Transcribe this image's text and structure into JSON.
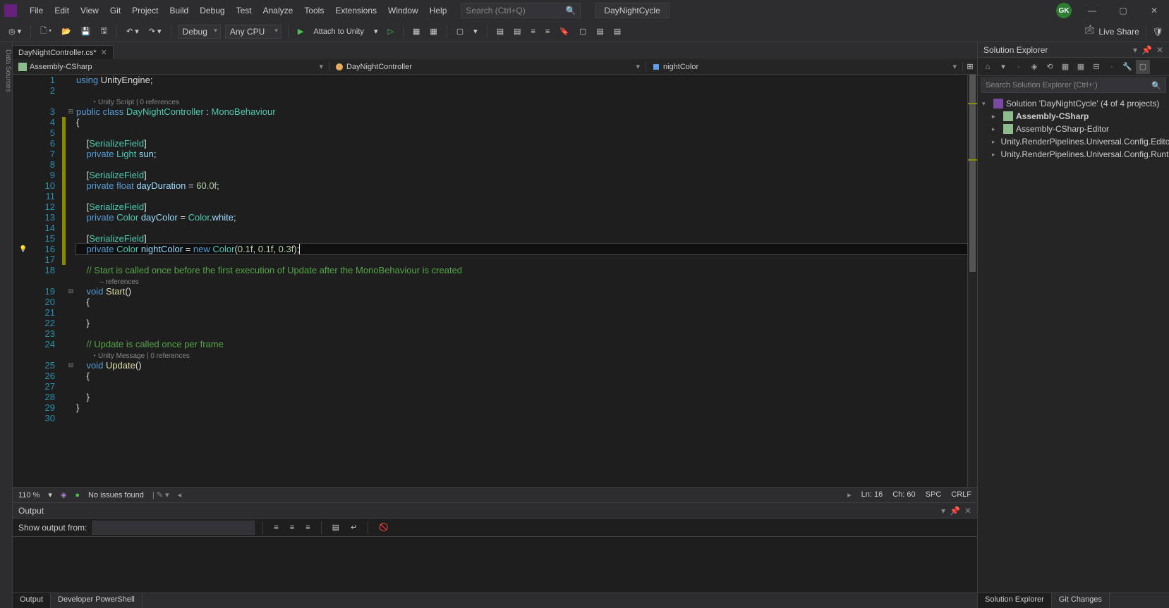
{
  "menubar": {
    "items": [
      "File",
      "Edit",
      "View",
      "Git",
      "Project",
      "Build",
      "Debug",
      "Test",
      "Analyze",
      "Tools",
      "Extensions",
      "Window",
      "Help"
    ],
    "search_placeholder": "Search (Ctrl+Q)",
    "project_name": "DayNightCycle",
    "user_initials": "GK"
  },
  "toolbar": {
    "config": "Debug",
    "platform": "Any CPU",
    "run_label": "Attach to Unity",
    "live_share": "Live Share"
  },
  "tabs": {
    "file": "DayNightController.cs*"
  },
  "navbar": {
    "project": "Assembly-CSharp",
    "class": "DayNightController",
    "member": "nightColor"
  },
  "code": {
    "lines": [
      {
        "n": 1,
        "mod": false,
        "fold": "",
        "seg": [
          [
            "kw",
            "using"
          ],
          [
            "plain",
            " "
          ],
          [
            "plain",
            "UnityEngine"
          ],
          [
            "plain",
            ";"
          ]
        ]
      },
      {
        "n": 2,
        "mod": false,
        "fold": "",
        "seg": []
      },
      {
        "n": null,
        "mod": false,
        "fold": "",
        "seg": [
          [
            "annot",
            "        ◔ Unity Script | 0 references"
          ]
        ]
      },
      {
        "n": 3,
        "mod": false,
        "fold": "⊟",
        "seg": [
          [
            "kw",
            "public"
          ],
          [
            "plain",
            " "
          ],
          [
            "kw",
            "class"
          ],
          [
            "plain",
            " "
          ],
          [
            "type",
            "DayNightController"
          ],
          [
            "plain",
            " : "
          ],
          [
            "type",
            "MonoBehaviour"
          ]
        ]
      },
      {
        "n": 4,
        "mod": true,
        "fold": "",
        "seg": [
          [
            "plain",
            "{"
          ]
        ]
      },
      {
        "n": 5,
        "mod": true,
        "fold": "",
        "seg": []
      },
      {
        "n": 6,
        "mod": true,
        "fold": "",
        "seg": [
          [
            "plain",
            "    ["
          ],
          [
            "type",
            "SerializeField"
          ],
          [
            "plain",
            "]"
          ]
        ]
      },
      {
        "n": 7,
        "mod": true,
        "fold": "",
        "seg": [
          [
            "plain",
            "    "
          ],
          [
            "kw",
            "private"
          ],
          [
            "plain",
            " "
          ],
          [
            "type",
            "Light"
          ],
          [
            "plain",
            " "
          ],
          [
            "var",
            "sun"
          ],
          [
            "plain",
            ";"
          ]
        ]
      },
      {
        "n": 8,
        "mod": true,
        "fold": "",
        "seg": []
      },
      {
        "n": 9,
        "mod": true,
        "fold": "",
        "seg": [
          [
            "plain",
            "    ["
          ],
          [
            "type",
            "SerializeField"
          ],
          [
            "plain",
            "]"
          ]
        ]
      },
      {
        "n": 10,
        "mod": true,
        "fold": "",
        "seg": [
          [
            "plain",
            "    "
          ],
          [
            "kw",
            "private"
          ],
          [
            "plain",
            " "
          ],
          [
            "kw",
            "float"
          ],
          [
            "plain",
            " "
          ],
          [
            "var",
            "dayDuration"
          ],
          [
            "plain",
            " = "
          ],
          [
            "num",
            "60.0f"
          ],
          [
            "plain",
            ";"
          ]
        ]
      },
      {
        "n": 11,
        "mod": true,
        "fold": "",
        "seg": []
      },
      {
        "n": 12,
        "mod": true,
        "fold": "",
        "seg": [
          [
            "plain",
            "    ["
          ],
          [
            "type",
            "SerializeField"
          ],
          [
            "plain",
            "]"
          ]
        ]
      },
      {
        "n": 13,
        "mod": true,
        "fold": "",
        "seg": [
          [
            "plain",
            "    "
          ],
          [
            "kw",
            "private"
          ],
          [
            "plain",
            " "
          ],
          [
            "type",
            "Color"
          ],
          [
            "plain",
            " "
          ],
          [
            "var",
            "dayColor"
          ],
          [
            "plain",
            " = "
          ],
          [
            "type",
            "Color"
          ],
          [
            "plain",
            "."
          ],
          [
            "var",
            "white"
          ],
          [
            "plain",
            ";"
          ]
        ]
      },
      {
        "n": 14,
        "mod": true,
        "fold": "",
        "seg": []
      },
      {
        "n": 15,
        "mod": true,
        "fold": "",
        "seg": [
          [
            "plain",
            "    ["
          ],
          [
            "type",
            "SerializeField"
          ],
          [
            "plain",
            "]"
          ]
        ]
      },
      {
        "n": 16,
        "mod": true,
        "fold": "",
        "hl": true,
        "margin": "💡",
        "seg": [
          [
            "plain",
            "    "
          ],
          [
            "kw",
            "private"
          ],
          [
            "plain",
            " "
          ],
          [
            "type",
            "Color"
          ],
          [
            "plain",
            " "
          ],
          [
            "var",
            "nightColor"
          ],
          [
            "plain",
            " = "
          ],
          [
            "kw",
            "new"
          ],
          [
            "plain",
            " "
          ],
          [
            "type",
            "Color"
          ],
          [
            "plain",
            "("
          ],
          [
            "num",
            "0.1f"
          ],
          [
            "plain",
            ", "
          ],
          [
            "num",
            "0.1f"
          ],
          [
            "plain",
            ", "
          ],
          [
            "num",
            "0.3f"
          ],
          [
            "plain",
            ");"
          ],
          [
            "caret",
            ""
          ]
        ]
      },
      {
        "n": 17,
        "mod": true,
        "fold": "",
        "seg": []
      },
      {
        "n": 18,
        "mod": false,
        "fold": "",
        "seg": [
          [
            "plain",
            "    "
          ],
          [
            "comment",
            "// Start is called once before the first execution of Update after the MonoBehaviour is created"
          ]
        ]
      },
      {
        "n": null,
        "mod": false,
        "fold": "",
        "seg": [
          [
            "annot",
            "            – references"
          ]
        ]
      },
      {
        "n": 19,
        "mod": false,
        "fold": "⊟",
        "seg": [
          [
            "plain",
            "    "
          ],
          [
            "kw",
            "void"
          ],
          [
            "plain",
            " "
          ],
          [
            "ident",
            "Start"
          ],
          [
            "plain",
            "()"
          ]
        ]
      },
      {
        "n": 20,
        "mod": false,
        "fold": "",
        "seg": [
          [
            "plain",
            "    {"
          ]
        ]
      },
      {
        "n": 21,
        "mod": false,
        "fold": "",
        "seg": []
      },
      {
        "n": 22,
        "mod": false,
        "fold": "",
        "seg": [
          [
            "plain",
            "    }"
          ]
        ]
      },
      {
        "n": 23,
        "mod": false,
        "fold": "",
        "seg": []
      },
      {
        "n": 24,
        "mod": false,
        "fold": "",
        "seg": [
          [
            "plain",
            "    "
          ],
          [
            "comment",
            "// Update is called once per frame"
          ]
        ]
      },
      {
        "n": null,
        "mod": false,
        "fold": "",
        "seg": [
          [
            "annot",
            "        ◔ Unity Message | 0 references"
          ]
        ]
      },
      {
        "n": 25,
        "mod": false,
        "fold": "⊟",
        "seg": [
          [
            "plain",
            "    "
          ],
          [
            "kw",
            "void"
          ],
          [
            "plain",
            " "
          ],
          [
            "ident",
            "Update"
          ],
          [
            "plain",
            "()"
          ]
        ]
      },
      {
        "n": 26,
        "mod": false,
        "fold": "",
        "seg": [
          [
            "plain",
            "    {"
          ]
        ]
      },
      {
        "n": 27,
        "mod": false,
        "fold": "",
        "seg": []
      },
      {
        "n": 28,
        "mod": false,
        "fold": "",
        "seg": [
          [
            "plain",
            "    }"
          ]
        ]
      },
      {
        "n": 29,
        "mod": false,
        "fold": "",
        "seg": [
          [
            "plain",
            "}"
          ]
        ]
      },
      {
        "n": 30,
        "mod": false,
        "fold": "",
        "seg": []
      }
    ]
  },
  "editor_status": {
    "zoom": "110 %",
    "issues": "No issues found",
    "line": "Ln: 16",
    "col": "Ch: 60",
    "indent": "SPC",
    "eol": "CRLF"
  },
  "explorer": {
    "title": "Solution Explorer",
    "search_placeholder": "Search Solution Explorer (Ctrl+:)",
    "solution": "Solution 'DayNightCycle' (4 of 4 projects)",
    "projects": [
      {
        "name": "Assembly-CSharp",
        "bold": true
      },
      {
        "name": "Assembly-CSharp-Editor",
        "bold": false
      },
      {
        "name": "Unity.RenderPipelines.Universal.Config.Editor.Tests",
        "bold": false
      },
      {
        "name": "Unity.RenderPipelines.Universal.Config.Runtime",
        "bold": false
      }
    ],
    "bottom_tabs": [
      "Solution Explorer",
      "Git Changes"
    ]
  },
  "output": {
    "title": "Output",
    "show_from_label": "Show output from:",
    "tabs": [
      "Output",
      "Developer PowerShell"
    ]
  },
  "side_tab_label": "Data Sources"
}
